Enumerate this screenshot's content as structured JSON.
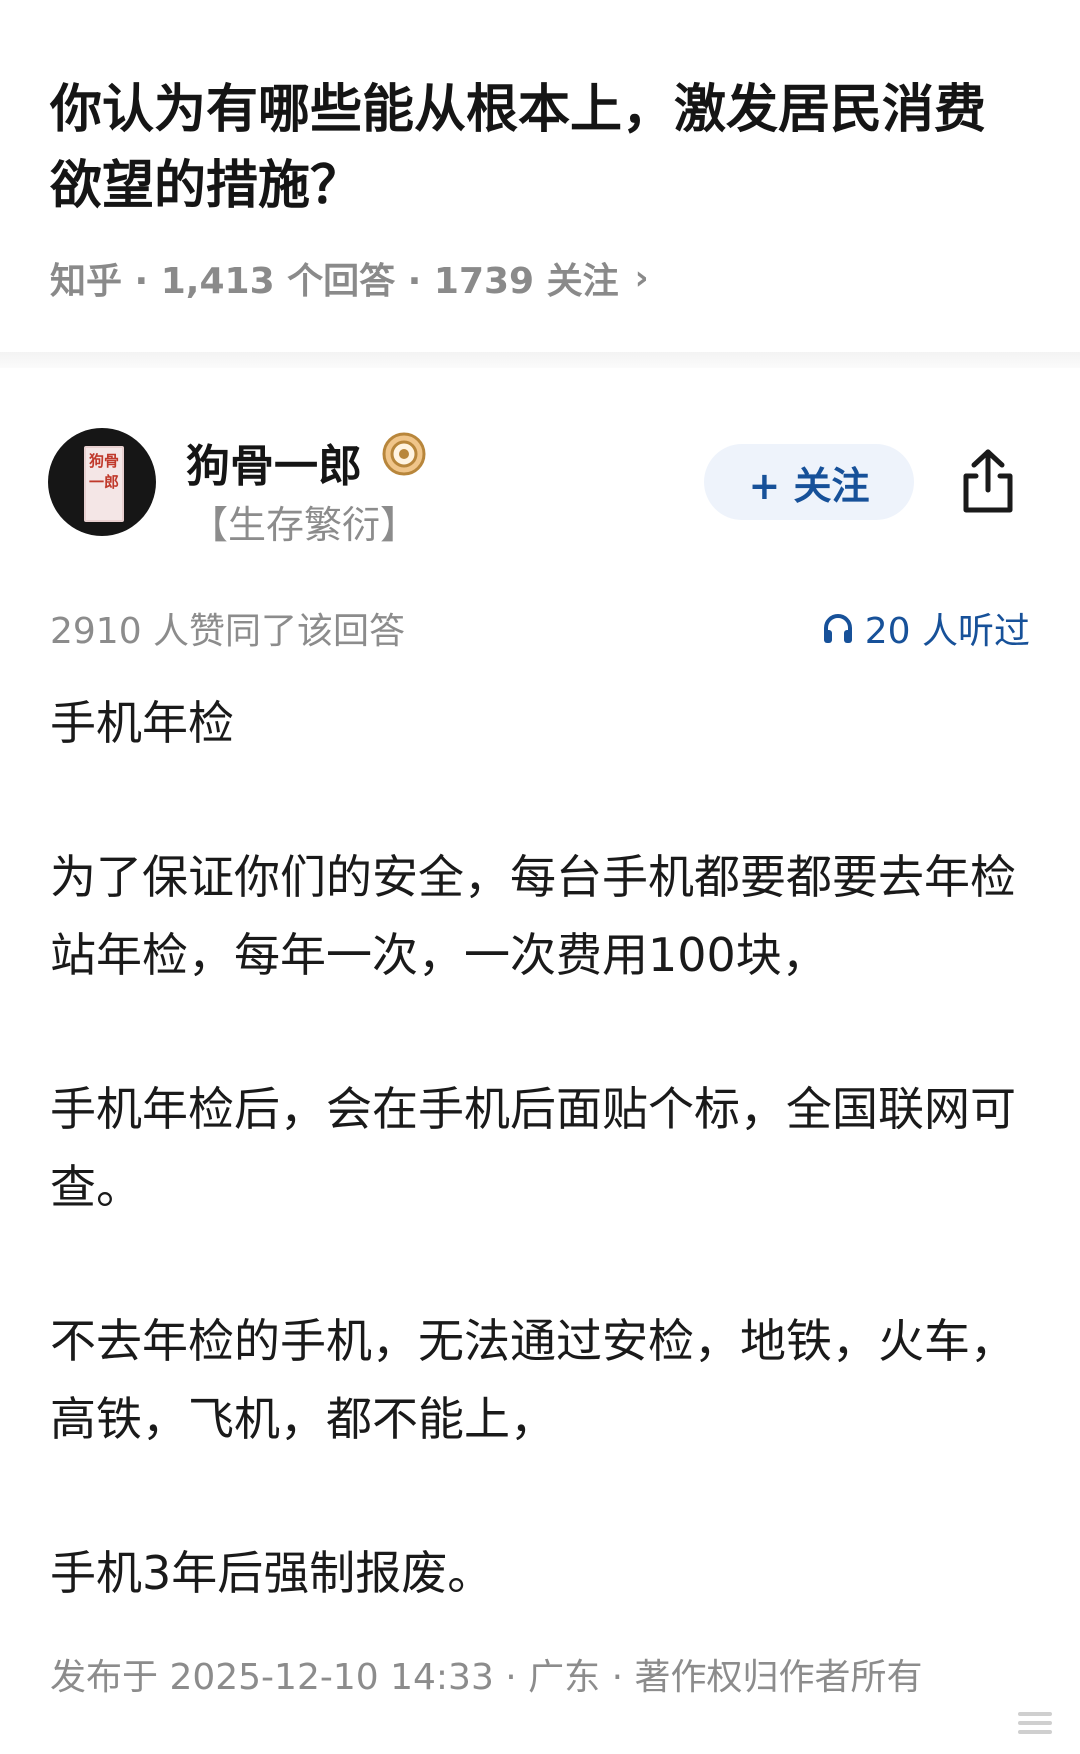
{
  "question": {
    "title": "你认为有哪些能从根本上，激发居民消费欲望的措施？",
    "meta": "知乎 · 1,413  个回答 · 1739  关注"
  },
  "author": {
    "name": "狗骨一郎",
    "tag": "【生存繁衍】",
    "avatar_text": "狗骨一郎",
    "follow_label": "+ 关注"
  },
  "stats": {
    "likes": "2910  人赞同了该回答",
    "listened": "20  人听过"
  },
  "answer": {
    "paragraphs": [
      "手机年检",
      "为了保证你们的安全，每台手机都要都要去年检站年检，每年一次，一次费用100块，",
      "手机年检后，会在手机后面贴个标，全国联网可查。",
      "不去年检的手机，无法通过安检，地铁，火车，高铁，飞机，都不能上，",
      "手机3年后强制报废。"
    ]
  },
  "footer": {
    "text": "发布于  2025-12-10  14:33 · 广东 · 著作权归作者所有"
  },
  "colors": {
    "accent": "#175199",
    "meta_gray": "#8c8c8c",
    "follow_bg": "#eef3fb"
  },
  "icons": [
    "chevron-right-icon",
    "badge-icon",
    "share-icon",
    "headphones-icon"
  ]
}
